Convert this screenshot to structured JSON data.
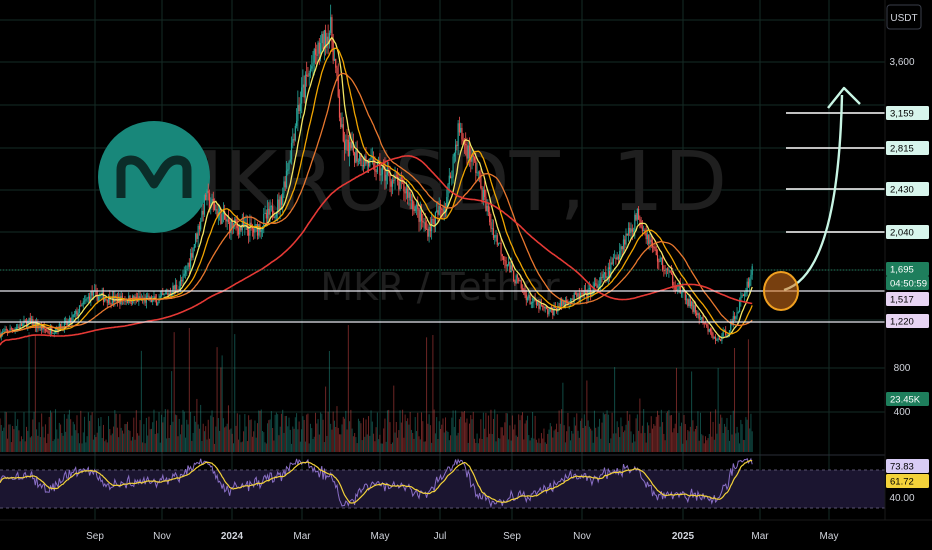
{
  "currency_label": "USDT",
  "watermark": {
    "symbol": "MKRUSDT, 1D",
    "pair": "MKR / Tether"
  },
  "colors": {
    "bg": "#000000",
    "up": "#26a69a",
    "down": "#ef5350",
    "ma_fast": "#f5e663",
    "ma_mid": "#f0a500",
    "ma_slow": "#e8772e",
    "ma_long": "#e53935",
    "logo": "#18877a",
    "arrow": "#c8f5e4",
    "rsi": "#8a6fc6",
    "rsi_ma": "#f3d23a"
  },
  "price_axis": {
    "labels": [
      "3,600",
      "800",
      "400"
    ],
    "badges": [
      {
        "text": "3,159",
        "bg": "#d7f5ec",
        "fg": "#000000"
      },
      {
        "text": "2,815",
        "bg": "#d7f5ec",
        "fg": "#000000"
      },
      {
        "text": "2,430",
        "bg": "#d7f5ec",
        "fg": "#000000"
      },
      {
        "text": "2,040",
        "bg": "#d7f5ec",
        "fg": "#000000"
      },
      {
        "text": "1,695",
        "bg": "#1e7e5c",
        "fg": "#ffffff"
      },
      {
        "text": "04:50:59",
        "bg": "#1e7e5c",
        "fg": "#ffffff"
      },
      {
        "text": "1,517",
        "bg": "#e7d4f3",
        "fg": "#000000"
      },
      {
        "text": "1,220",
        "bg": "#e7d4f3",
        "fg": "#000000"
      },
      {
        "text": "23.45K",
        "bg": "#1e7e5c",
        "fg": "#ffffff"
      }
    ]
  },
  "rsi_axis": {
    "labels": [
      "40.00"
    ],
    "badges": [
      {
        "text": "73.83",
        "bg": "#d8ccf5",
        "fg": "#000000"
      },
      {
        "text": "61.72",
        "bg": "#f3d23a",
        "fg": "#000000"
      }
    ]
  },
  "time_axis": [
    "Sep",
    "Nov",
    "2024",
    "Mar",
    "May",
    "Jul",
    "Sep",
    "Nov",
    "2025",
    "Mar",
    "May"
  ],
  "annotations": {
    "targets": [
      3159,
      2815,
      2430,
      2040
    ],
    "support_levels": [
      1517,
      1220
    ],
    "current_price": 1695
  },
  "chart_data": {
    "type": "candlestick",
    "title": "",
    "x_unit": "date",
    "y_unit": "USDT",
    "x_range": [
      "2023-07-18",
      "2025-05-31"
    ],
    "y_range_estimate": [
      350,
      4300
    ],
    "price_path": [
      [
        "2023-07-20",
        1100
      ],
      [
        "2023-08-10",
        1220
      ],
      [
        "2023-08-25",
        1120
      ],
      [
        "2023-09-10",
        1200
      ],
      [
        "2023-09-28",
        1480
      ],
      [
        "2023-10-15",
        1430
      ],
      [
        "2023-11-01",
        1430
      ],
      [
        "2023-11-20",
        1420
      ],
      [
        "2023-12-10",
        1600
      ],
      [
        "2023-12-28",
        2350
      ],
      [
        "2024-01-15",
        2100
      ],
      [
        "2024-02-05",
        2050
      ],
      [
        "2024-02-25",
        2300
      ],
      [
        "2024-03-10",
        3200
      ],
      [
        "2024-03-25",
        3700
      ],
      [
        "2024-04-05",
        4000
      ],
      [
        "2024-04-15",
        2850
      ],
      [
        "2024-05-01",
        2700
      ],
      [
        "2024-05-20",
        2550
      ],
      [
        "2024-06-05",
        2400
      ],
      [
        "2024-06-20",
        2050
      ],
      [
        "2024-07-05",
        2300
      ],
      [
        "2024-07-15",
        3000
      ],
      [
        "2024-07-30",
        2600
      ],
      [
        "2024-08-10",
        2100
      ],
      [
        "2024-08-25",
        1700
      ],
      [
        "2024-09-10",
        1420
      ],
      [
        "2024-09-25",
        1300
      ],
      [
        "2024-10-10",
        1430
      ],
      [
        "2024-10-25",
        1480
      ],
      [
        "2024-11-10",
        1650
      ],
      [
        "2024-11-25",
        2000
      ],
      [
        "2024-12-05",
        2200
      ],
      [
        "2024-12-20",
        1800
      ],
      [
        "2025-01-05",
        1550
      ],
      [
        "2025-01-20",
        1300
      ],
      [
        "2025-02-05",
        1020
      ],
      [
        "2025-02-15",
        1150
      ],
      [
        "2025-02-25",
        1450
      ],
      [
        "2025-03-05",
        1695
      ]
    ],
    "series": [
      {
        "name": "",
        "role": "fast moving average",
        "color": "#f5e663"
      },
      {
        "name": "",
        "role": "medium moving average",
        "color": "#f0a500"
      },
      {
        "name": "",
        "role": "slow moving average",
        "color": "#e8772e"
      },
      {
        "name": "",
        "role": "long moving average",
        "color": "#e53935"
      }
    ],
    "rsi": {
      "last": 73.83,
      "signal": 61.72,
      "levels": [
        70,
        30
      ],
      "range": [
        0,
        100
      ]
    },
    "volume_last": "23.45K",
    "grid": true,
    "legend": "none"
  }
}
